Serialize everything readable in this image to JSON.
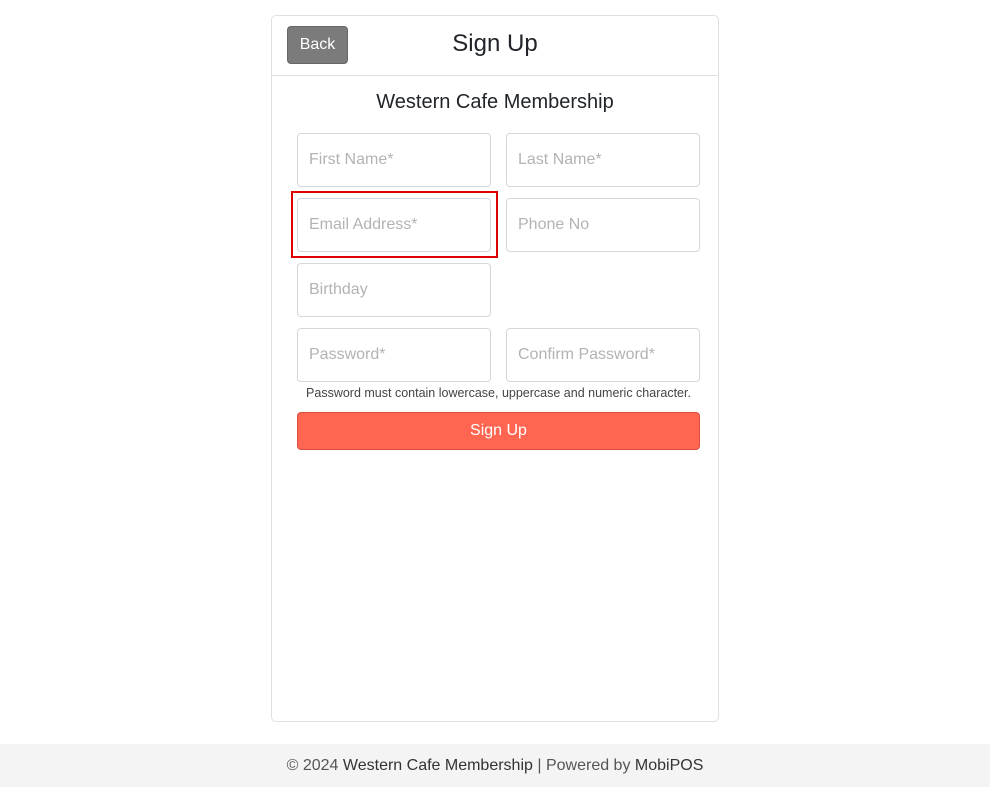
{
  "header": {
    "back_label": "Back",
    "title": "Sign Up"
  },
  "form": {
    "subtitle": "Western Cafe Membership",
    "fields": {
      "first_name": {
        "placeholder": "First Name*",
        "value": ""
      },
      "last_name": {
        "placeholder": "Last Name*",
        "value": ""
      },
      "email": {
        "placeholder": "Email Address*",
        "value": ""
      },
      "phone": {
        "placeholder": "Phone No",
        "value": ""
      },
      "birthday": {
        "placeholder": "Birthday",
        "value": ""
      },
      "password": {
        "placeholder": "Password*",
        "value": ""
      },
      "confirm_password": {
        "placeholder": "Confirm Password*",
        "value": ""
      }
    },
    "password_hint": "Password must contain lowercase, uppercase and numeric character.",
    "submit_label": "Sign Up"
  },
  "footer": {
    "copyright": "© 2024",
    "brand": "Western Cafe Membership",
    "separator": "| Powered by",
    "powered_by": "MobiPOS"
  },
  "colors": {
    "accent": "#ff6550",
    "back_button": "#7b7b7b",
    "highlight": "#e00000"
  }
}
